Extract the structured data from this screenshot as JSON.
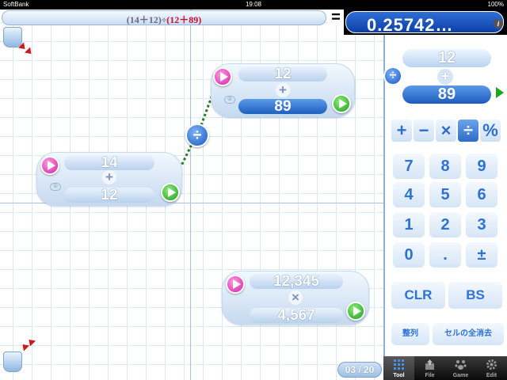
{
  "status_bar": {
    "carrier": "SoftBank",
    "time": "19:08",
    "battery": "100%"
  },
  "expression": {
    "part_grey": "(14＋12)÷",
    "part_red": "(12＋89)"
  },
  "equals_sign": "=",
  "result": {
    "value": "0.25742…",
    "info": "i"
  },
  "cells": [
    {
      "top": "12",
      "operator": "+",
      "bottom": "89",
      "index": "②"
    },
    {
      "top": "14",
      "operator": "+",
      "bottom": "12",
      "index": "①"
    },
    {
      "top": "12,345",
      "operator": "×",
      "bottom": "4,567"
    }
  ],
  "divide_node": "÷",
  "pager": "03 / 20",
  "panel": {
    "cell": {
      "top": "12",
      "operator": "+",
      "bottom": "89",
      "link_operator": "÷"
    },
    "operators": [
      "+",
      "−",
      "×",
      "÷",
      "%"
    ],
    "active_operator": "÷",
    "keys": [
      "7",
      "8",
      "9",
      "4",
      "5",
      "6",
      "1",
      "2",
      "3",
      "0",
      ".",
      "±"
    ],
    "clear": "CLR",
    "backspace": "BS",
    "align": "整列",
    "delete_all": "セルの全消去"
  },
  "tabs": [
    {
      "label": "Tool",
      "icon": "tool-icon",
      "active": true
    },
    {
      "label": "File",
      "icon": "file-icon",
      "active": false
    },
    {
      "label": "Game",
      "icon": "game-icon",
      "active": false
    },
    {
      "label": "Edit",
      "icon": "gear-icon",
      "active": false
    }
  ],
  "colors": {
    "accent": "#2d72d6",
    "result_bg": "#0c3fa8",
    "play_pink": "#d41ca8",
    "play_green": "#1d9b18",
    "expr_red": "#c8102e"
  }
}
